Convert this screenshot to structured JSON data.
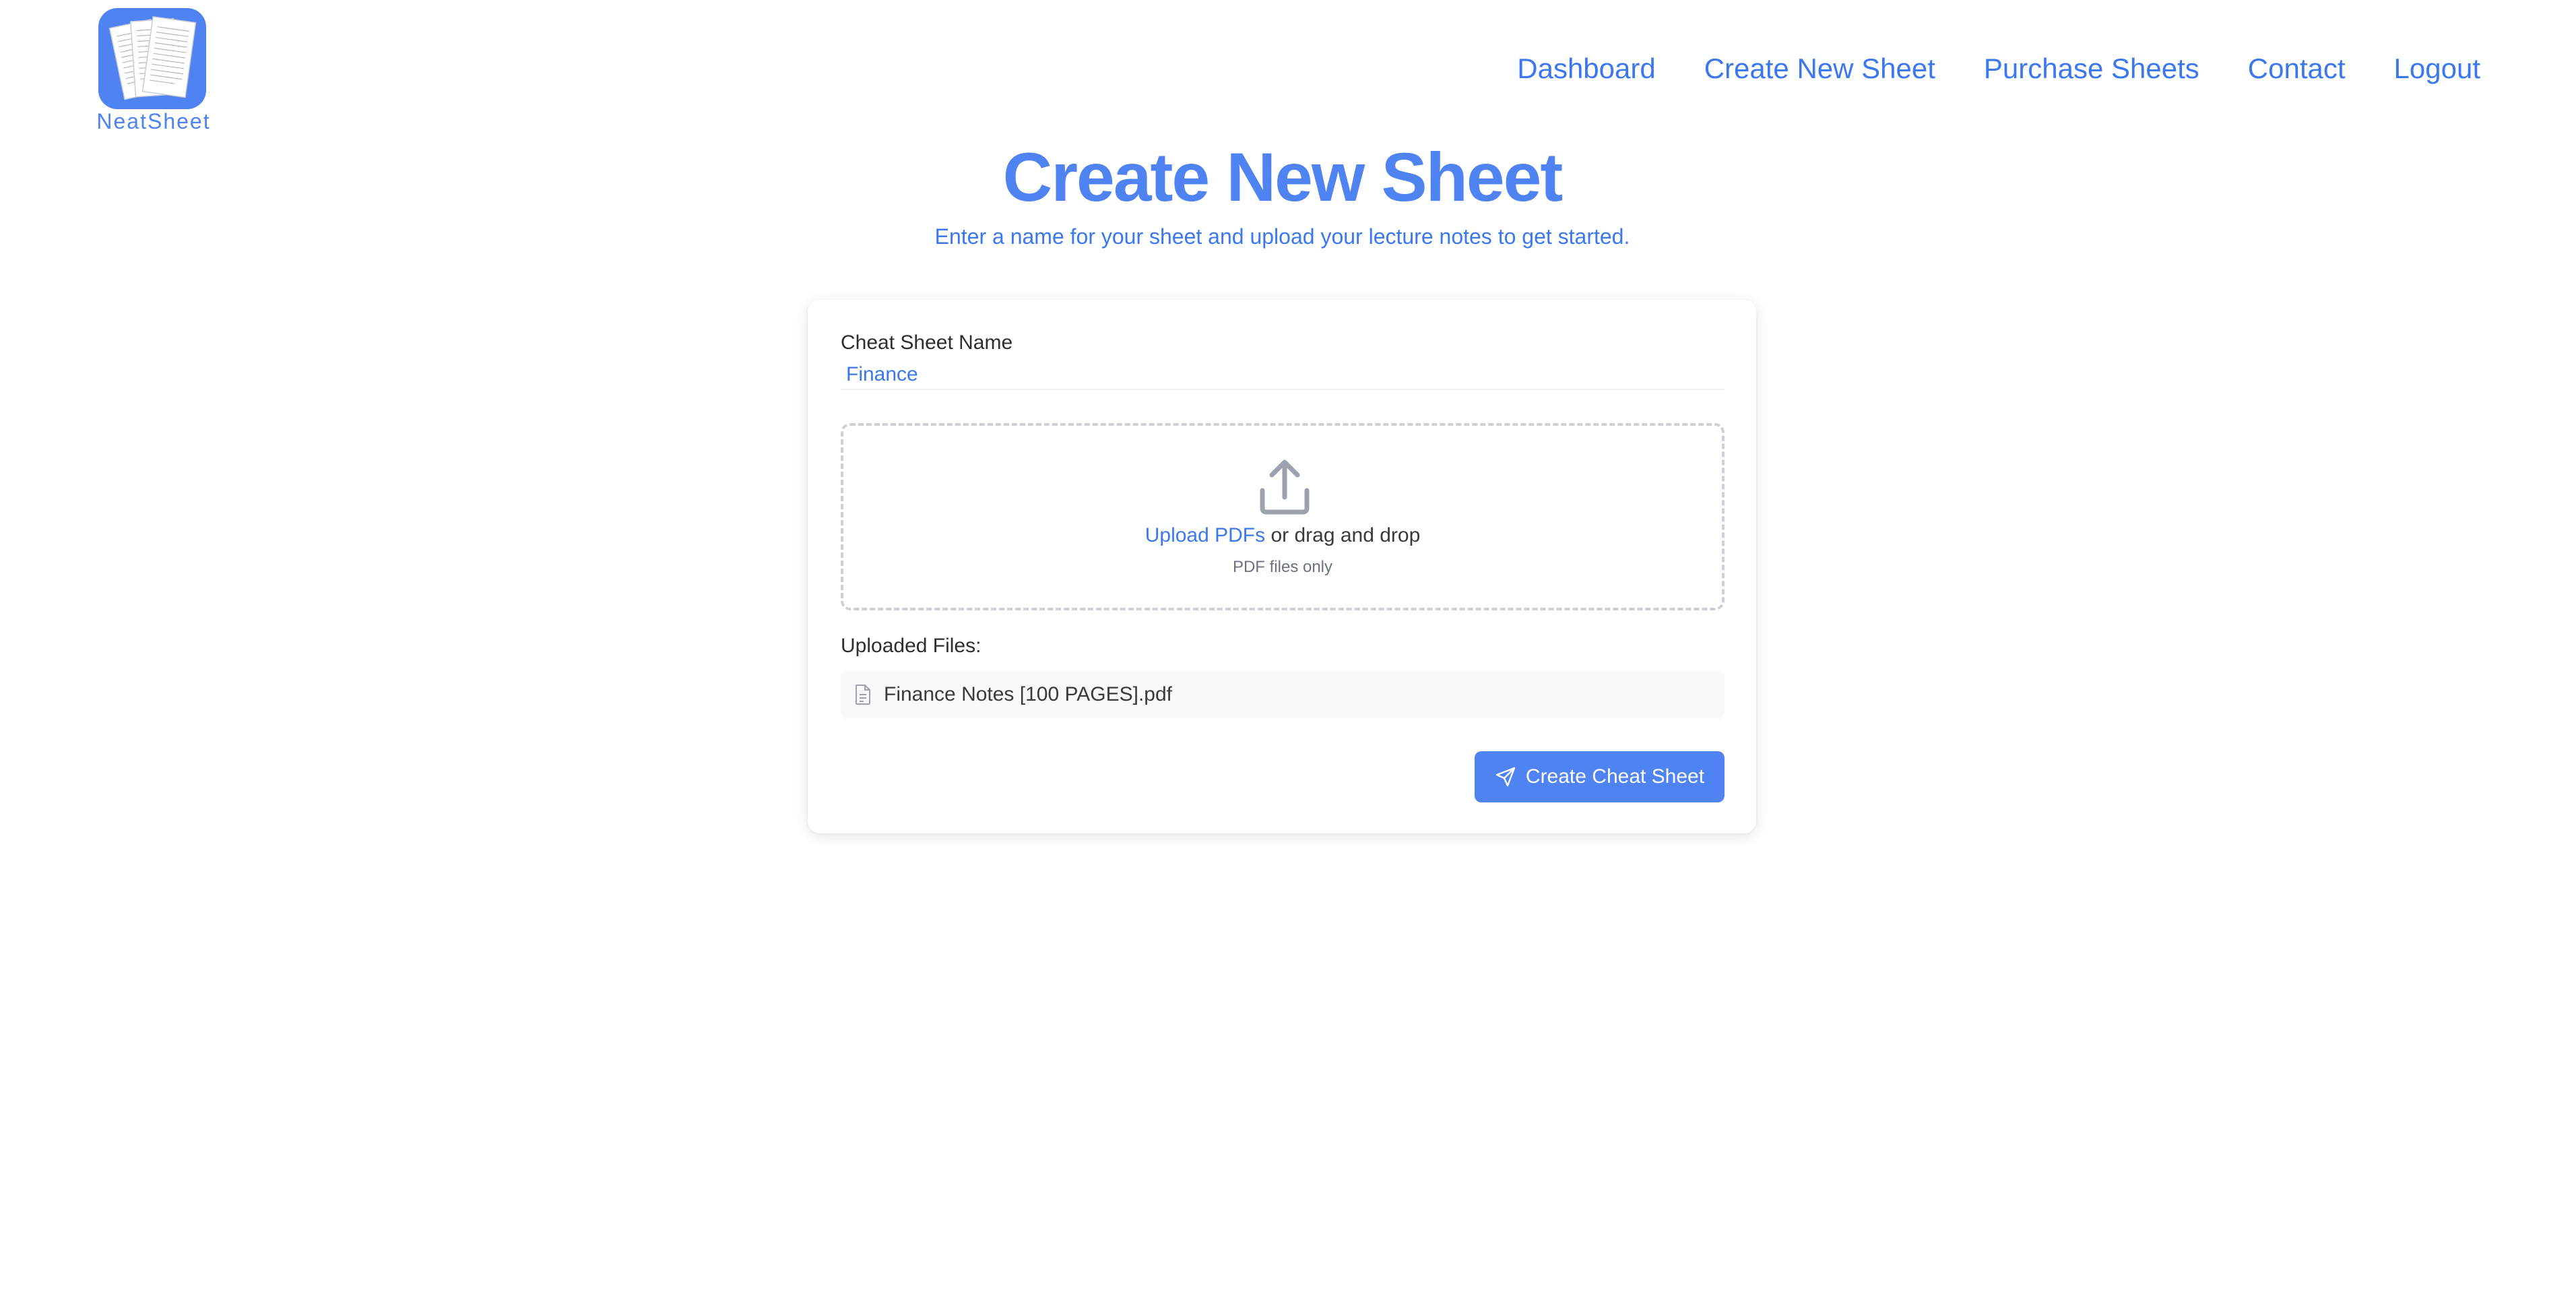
{
  "brand": {
    "name": "NeatSheet",
    "accent_color": "#4f83f1",
    "logo_icon": "stacked-pages-logo"
  },
  "nav": {
    "items": [
      {
        "label": "Dashboard"
      },
      {
        "label": "Create New Sheet"
      },
      {
        "label": "Purchase Sheets"
      },
      {
        "label": "Contact"
      },
      {
        "label": "Logout"
      }
    ]
  },
  "header": {
    "title": "Create New Sheet",
    "subtitle": "Enter a name for your sheet and upload your lecture notes to get started."
  },
  "form": {
    "name_label": "Cheat Sheet Name",
    "name_value": "Finance",
    "upload": {
      "icon": "upload-icon",
      "link_text": "Upload PDFs",
      "rest_text": " or drag and drop",
      "hint": "PDF files only"
    },
    "uploaded_label": "Uploaded Files:",
    "files": [
      {
        "name": "Finance Notes [100 PAGES].pdf",
        "icon": "document-icon"
      }
    ],
    "submit_label": "Create Cheat Sheet",
    "submit_icon": "send-icon"
  }
}
